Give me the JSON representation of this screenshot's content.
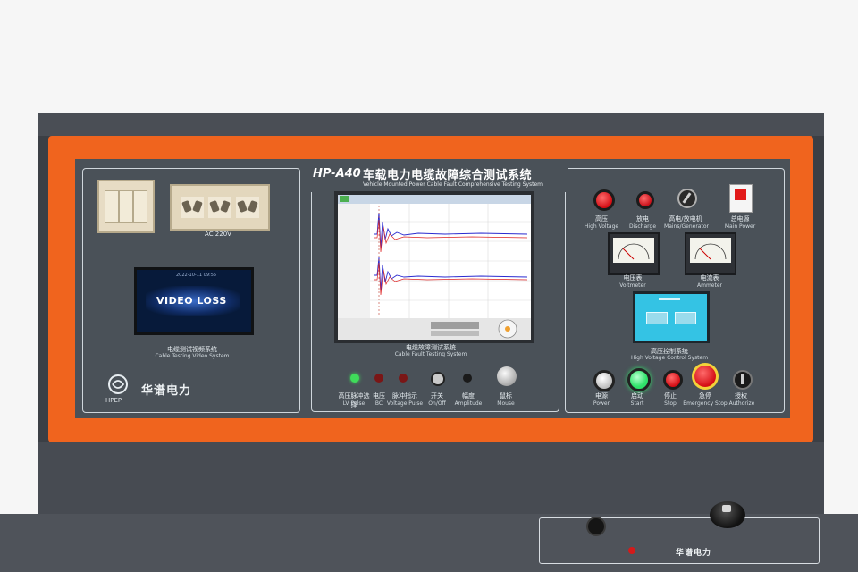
{
  "header": {
    "model": "HP-A40",
    "title_cn": "车载电力电缆故障综合测试系统",
    "title_en": "Vehicle Mounted Power Cable Fault Comprehensive Testing System"
  },
  "left_section": {
    "socket_label": "AC 220V",
    "video_timestamp": "2022-10-11 09:55",
    "video_status": "VIDEO LOSS",
    "camera_label_cn": "电缆测试视频系统",
    "camera_label_en": "Cable Testing Video System",
    "brand_cn": "华谱电力",
    "brand_en": "HPEP"
  },
  "center_section": {
    "scope_label_cn": "电缆故障测试系统",
    "scope_label_en": "Cable Fault Testing System",
    "controls": [
      {
        "cn": "高压脉冲选择",
        "en": "LV Pulse"
      },
      {
        "cn": "电压",
        "en": "BC"
      },
      {
        "cn": "脉冲指示",
        "en": "Voltage Pulse"
      },
      {
        "cn": "开关",
        "en": "On/Off"
      },
      {
        "cn": "幅度",
        "en": "Amplitude"
      },
      {
        "cn": "鼠标",
        "en": "Mouse"
      }
    ]
  },
  "right_section": {
    "top_controls": [
      {
        "cn": "高压",
        "en": "High Voltage"
      },
      {
        "cn": "放电",
        "en": "Discharge"
      },
      {
        "cn": "高电/放电机",
        "en": "Mains/Generator"
      },
      {
        "cn": "总电源",
        "en": "Main Power"
      }
    ],
    "meters": [
      {
        "cn": "电压表",
        "en": "Voltmeter"
      },
      {
        "cn": "电流表",
        "en": "Ammeter"
      }
    ],
    "hmi_label_cn": "高压控制系统",
    "hmi_label_en": "High Voltage Control System",
    "bottom_controls": [
      {
        "cn": "电源",
        "en": "Power"
      },
      {
        "cn": "启动",
        "en": "Start"
      },
      {
        "cn": "停止",
        "en": "Stop"
      },
      {
        "cn": "急停",
        "en": "Emergency Stop"
      },
      {
        "cn": "授权",
        "en": "Authorize"
      }
    ]
  },
  "lower_panel": {
    "brand_cn": "华谱电力"
  },
  "colors": {
    "frame_orange": "#f0641e",
    "panel_gray": "#4a5158",
    "cabinet_gray": "#3b3f45",
    "red_button": "#e0141e",
    "green_button": "#2fe36a"
  }
}
